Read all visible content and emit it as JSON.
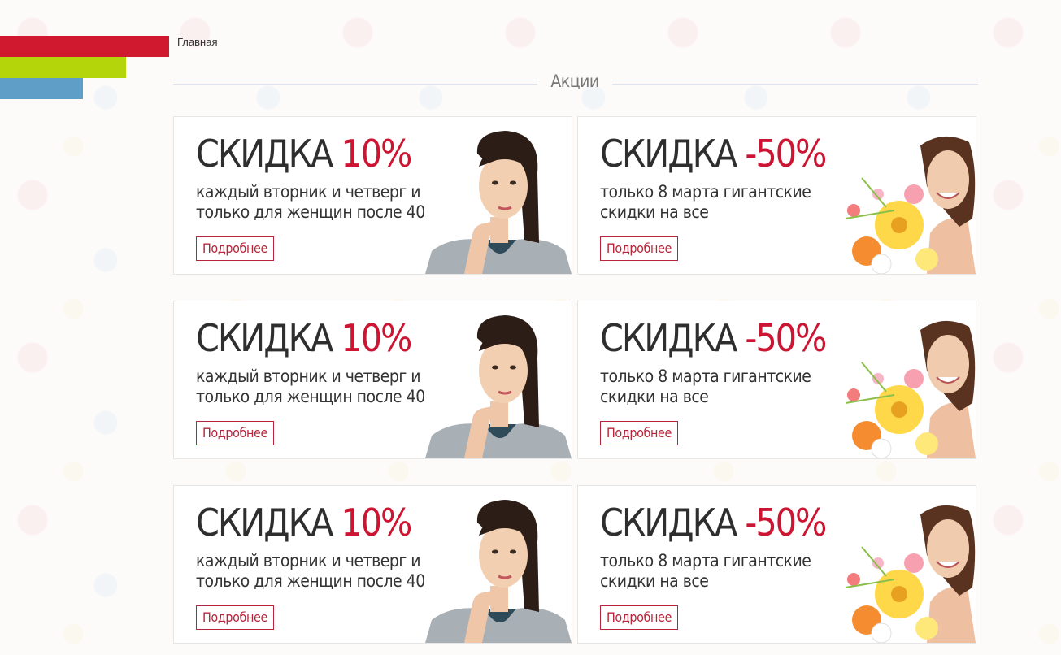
{
  "breadcrumb": {
    "home": "Главная"
  },
  "section": {
    "title": "Акции"
  },
  "colors": {
    "stripe_red": "#d0182f",
    "stripe_green": "#b5d50b",
    "stripe_blue": "#5f9fc7",
    "accent_red": "#cc1532"
  },
  "cards": [
    {
      "head": "СКИДКА",
      "percent": "10%",
      "line1": "каждый вторник и четверг и",
      "line2": "только для женщин после 40",
      "button": "Подробнее",
      "image_icon": "thinking-woman-illustration"
    },
    {
      "head": "СКИДКА",
      "percent": "-50%",
      "line1": "только 8 марта гигантские",
      "line2": "скидки на все",
      "button": "Подробнее",
      "image_icon": "woman-with-flowers-illustration"
    },
    {
      "head": "СКИДКА",
      "percent": "10%",
      "line1": "каждый вторник и четверг и",
      "line2": "только для женщин после 40",
      "button": "Подробнее",
      "image_icon": "thinking-woman-illustration"
    },
    {
      "head": "СКИДКА",
      "percent": "-50%",
      "line1": "только 8 марта гигантские",
      "line2": "скидки на все",
      "button": "Подробнее",
      "image_icon": "woman-with-flowers-illustration"
    },
    {
      "head": "СКИДКА",
      "percent": "10%",
      "line1": "каждый вторник и четверг и",
      "line2": "только для женщин после 40",
      "button": "Подробнее",
      "image_icon": "thinking-woman-illustration"
    },
    {
      "head": "СКИДКА",
      "percent": "-50%",
      "line1": "только 8 марта гигантские",
      "line2": "скидки на все",
      "button": "Подробнее",
      "image_icon": "woman-with-flowers-illustration"
    }
  ]
}
